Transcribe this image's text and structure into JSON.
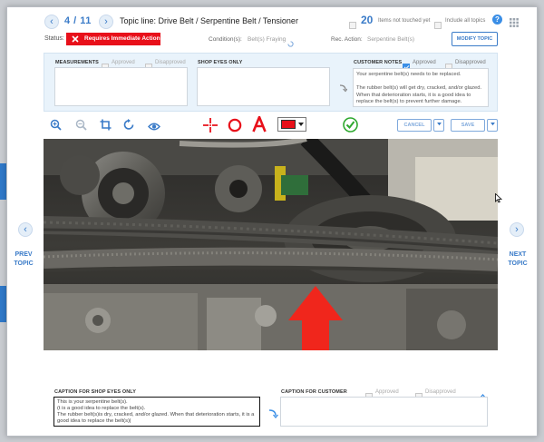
{
  "header": {
    "counter": "4 / 11",
    "topic_line": "Topic line: Drive Belt / Serpentine Belt / Tensioner",
    "untouched_count": "20",
    "untouched_label": "Items not touched yet",
    "include_all_label": "Include all topics"
  },
  "status": {
    "label": "Status:",
    "badge": "Requires Immediate Action",
    "badge_color": "#e8101a",
    "conditions_label": "Condition(s):",
    "conditions_value": "Belt(s) Fraying",
    "rec_action_label": "Rec. Action:",
    "rec_action_value": "Serpentine Belt(s)",
    "modify_button": "MODIFY TOPIC"
  },
  "panel": {
    "measurements_label": "MEASUREMENTS",
    "approved_label": "Approved",
    "disapproved_label": "Disapproved",
    "shop_eyes_label": "SHOP EYES ONLY",
    "customer_notes_label": "CUSTOMER NOTES",
    "customer_approved_label": "Approved",
    "customer_disapproved_label": "Disapproved",
    "customer_notes_text": "Your serpentine belt(s) needs to be replaced.\n\nThe rubber belt(s) will get dry, cracked, and/or glazed. When that deterioration starts, it is a good idea to replace the belt(s) to prevent further damage."
  },
  "toolbar": {
    "color_swatch": "#e8101a",
    "cancel_label": "CANCEL",
    "save_label": "SAVE",
    "accent_color": "#3a7bc8"
  },
  "nav": {
    "prev_line1": "PREV",
    "prev_line2": "TOPIC",
    "next_line1": "NEXT",
    "next_line2": "TOPIC"
  },
  "captions": {
    "shop_label": "CAPTION FOR SHOP EYES ONLY",
    "shop_text": "This is your serpentine belt(s).\n(t is a good idea to replace the belt(s).\nThe rubber belt(s)is dry, cracked, and/or glazed. When that deterioration starts, it is a good idea to replace the belt(s)|",
    "customer_label": "CAPTION FOR CUSTOMER",
    "approved_label": "Approved",
    "disapproved_label": "Disapproved"
  }
}
